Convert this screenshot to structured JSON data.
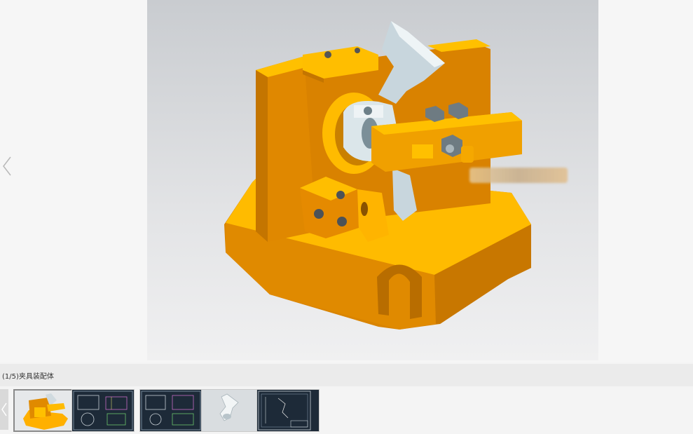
{
  "viewer": {
    "caption": "(1/5)夹具装配体",
    "main_image_alt": "夹具装配体",
    "thumbnails": [
      {
        "name": "thumb-assembly-3d",
        "active": true
      },
      {
        "name": "thumb-drawing-1",
        "active": false
      },
      {
        "name": "thumb-drawing-2",
        "active": false
      },
      {
        "name": "thumb-part-3d",
        "active": false
      },
      {
        "name": "thumb-drawing-3",
        "active": false
      }
    ]
  },
  "colors": {
    "orange_light": "#ffb400",
    "orange_dark": "#d98200",
    "steel": "#c8d4da"
  }
}
